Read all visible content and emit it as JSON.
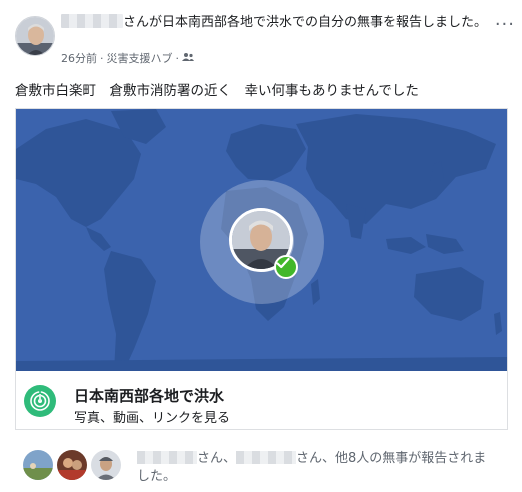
{
  "post": {
    "author_suffix": "さんが",
    "event_link": "日本南西部各地で洪水",
    "action_text": "での自分の無事を報告しました。",
    "timestamp": "26分前",
    "separator": "·",
    "source": "災害支援ハブ",
    "privacy_separator": "·",
    "more_label": "···",
    "body_text": "倉敷市白楽町　倉敷市消防署の近く　幸い何事もありませんでした"
  },
  "card": {
    "title": "日本南西部各地で洪水",
    "subtitle": "写真、動画、リンクを見る"
  },
  "others": {
    "name1_suffix": "さん、",
    "name2_suffix": "さん、",
    "rest": "他8人の無事が報告されました。"
  },
  "colors": {
    "map_bg": "#3b63ad",
    "land": "#2f5598",
    "check": "#42b72a",
    "safety_icon": "#2fbb7a"
  },
  "icons": {
    "more": "more-options-icon",
    "privacy": "friends-icon",
    "safety": "safety-check-icon",
    "check": "checkmark-icon"
  }
}
